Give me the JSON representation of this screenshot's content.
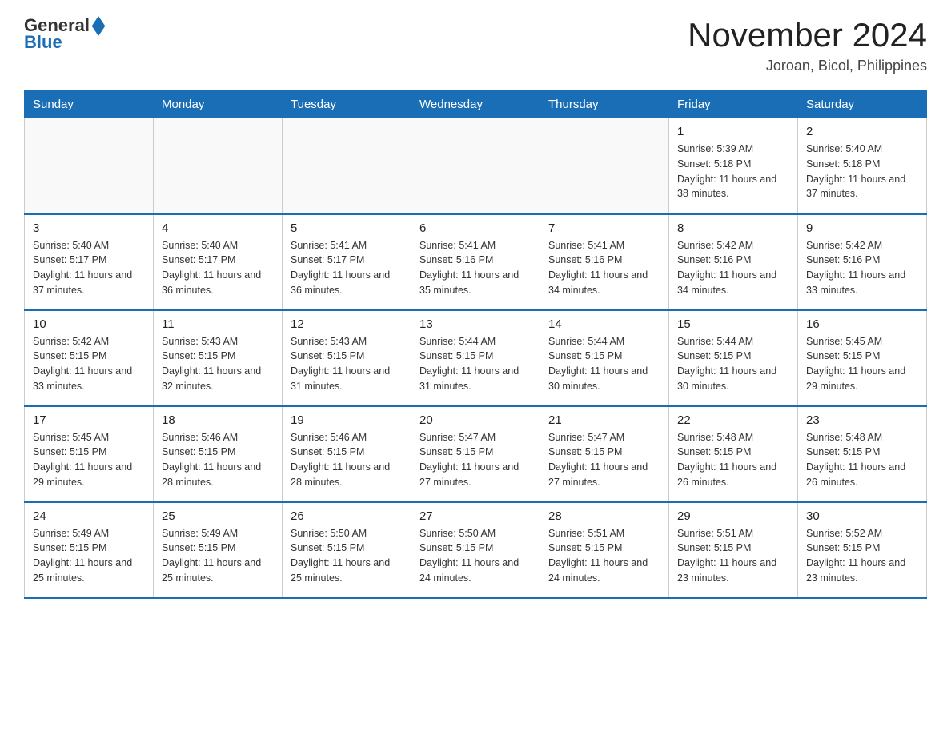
{
  "header": {
    "logo_general": "General",
    "logo_blue": "Blue",
    "month_title": "November 2024",
    "location": "Joroan, Bicol, Philippines"
  },
  "days_of_week": [
    "Sunday",
    "Monday",
    "Tuesday",
    "Wednesday",
    "Thursday",
    "Friday",
    "Saturday"
  ],
  "weeks": [
    {
      "days": [
        {
          "number": "",
          "info": ""
        },
        {
          "number": "",
          "info": ""
        },
        {
          "number": "",
          "info": ""
        },
        {
          "number": "",
          "info": ""
        },
        {
          "number": "",
          "info": ""
        },
        {
          "number": "1",
          "info": "Sunrise: 5:39 AM\nSunset: 5:18 PM\nDaylight: 11 hours and 38 minutes."
        },
        {
          "number": "2",
          "info": "Sunrise: 5:40 AM\nSunset: 5:18 PM\nDaylight: 11 hours and 37 minutes."
        }
      ]
    },
    {
      "days": [
        {
          "number": "3",
          "info": "Sunrise: 5:40 AM\nSunset: 5:17 PM\nDaylight: 11 hours and 37 minutes."
        },
        {
          "number": "4",
          "info": "Sunrise: 5:40 AM\nSunset: 5:17 PM\nDaylight: 11 hours and 36 minutes."
        },
        {
          "number": "5",
          "info": "Sunrise: 5:41 AM\nSunset: 5:17 PM\nDaylight: 11 hours and 36 minutes."
        },
        {
          "number": "6",
          "info": "Sunrise: 5:41 AM\nSunset: 5:16 PM\nDaylight: 11 hours and 35 minutes."
        },
        {
          "number": "7",
          "info": "Sunrise: 5:41 AM\nSunset: 5:16 PM\nDaylight: 11 hours and 34 minutes."
        },
        {
          "number": "8",
          "info": "Sunrise: 5:42 AM\nSunset: 5:16 PM\nDaylight: 11 hours and 34 minutes."
        },
        {
          "number": "9",
          "info": "Sunrise: 5:42 AM\nSunset: 5:16 PM\nDaylight: 11 hours and 33 minutes."
        }
      ]
    },
    {
      "days": [
        {
          "number": "10",
          "info": "Sunrise: 5:42 AM\nSunset: 5:15 PM\nDaylight: 11 hours and 33 minutes."
        },
        {
          "number": "11",
          "info": "Sunrise: 5:43 AM\nSunset: 5:15 PM\nDaylight: 11 hours and 32 minutes."
        },
        {
          "number": "12",
          "info": "Sunrise: 5:43 AM\nSunset: 5:15 PM\nDaylight: 11 hours and 31 minutes."
        },
        {
          "number": "13",
          "info": "Sunrise: 5:44 AM\nSunset: 5:15 PM\nDaylight: 11 hours and 31 minutes."
        },
        {
          "number": "14",
          "info": "Sunrise: 5:44 AM\nSunset: 5:15 PM\nDaylight: 11 hours and 30 minutes."
        },
        {
          "number": "15",
          "info": "Sunrise: 5:44 AM\nSunset: 5:15 PM\nDaylight: 11 hours and 30 minutes."
        },
        {
          "number": "16",
          "info": "Sunrise: 5:45 AM\nSunset: 5:15 PM\nDaylight: 11 hours and 29 minutes."
        }
      ]
    },
    {
      "days": [
        {
          "number": "17",
          "info": "Sunrise: 5:45 AM\nSunset: 5:15 PM\nDaylight: 11 hours and 29 minutes."
        },
        {
          "number": "18",
          "info": "Sunrise: 5:46 AM\nSunset: 5:15 PM\nDaylight: 11 hours and 28 minutes."
        },
        {
          "number": "19",
          "info": "Sunrise: 5:46 AM\nSunset: 5:15 PM\nDaylight: 11 hours and 28 minutes."
        },
        {
          "number": "20",
          "info": "Sunrise: 5:47 AM\nSunset: 5:15 PM\nDaylight: 11 hours and 27 minutes."
        },
        {
          "number": "21",
          "info": "Sunrise: 5:47 AM\nSunset: 5:15 PM\nDaylight: 11 hours and 27 minutes."
        },
        {
          "number": "22",
          "info": "Sunrise: 5:48 AM\nSunset: 5:15 PM\nDaylight: 11 hours and 26 minutes."
        },
        {
          "number": "23",
          "info": "Sunrise: 5:48 AM\nSunset: 5:15 PM\nDaylight: 11 hours and 26 minutes."
        }
      ]
    },
    {
      "days": [
        {
          "number": "24",
          "info": "Sunrise: 5:49 AM\nSunset: 5:15 PM\nDaylight: 11 hours and 25 minutes."
        },
        {
          "number": "25",
          "info": "Sunrise: 5:49 AM\nSunset: 5:15 PM\nDaylight: 11 hours and 25 minutes."
        },
        {
          "number": "26",
          "info": "Sunrise: 5:50 AM\nSunset: 5:15 PM\nDaylight: 11 hours and 25 minutes."
        },
        {
          "number": "27",
          "info": "Sunrise: 5:50 AM\nSunset: 5:15 PM\nDaylight: 11 hours and 24 minutes."
        },
        {
          "number": "28",
          "info": "Sunrise: 5:51 AM\nSunset: 5:15 PM\nDaylight: 11 hours and 24 minutes."
        },
        {
          "number": "29",
          "info": "Sunrise: 5:51 AM\nSunset: 5:15 PM\nDaylight: 11 hours and 23 minutes."
        },
        {
          "number": "30",
          "info": "Sunrise: 5:52 AM\nSunset: 5:15 PM\nDaylight: 11 hours and 23 minutes."
        }
      ]
    }
  ]
}
